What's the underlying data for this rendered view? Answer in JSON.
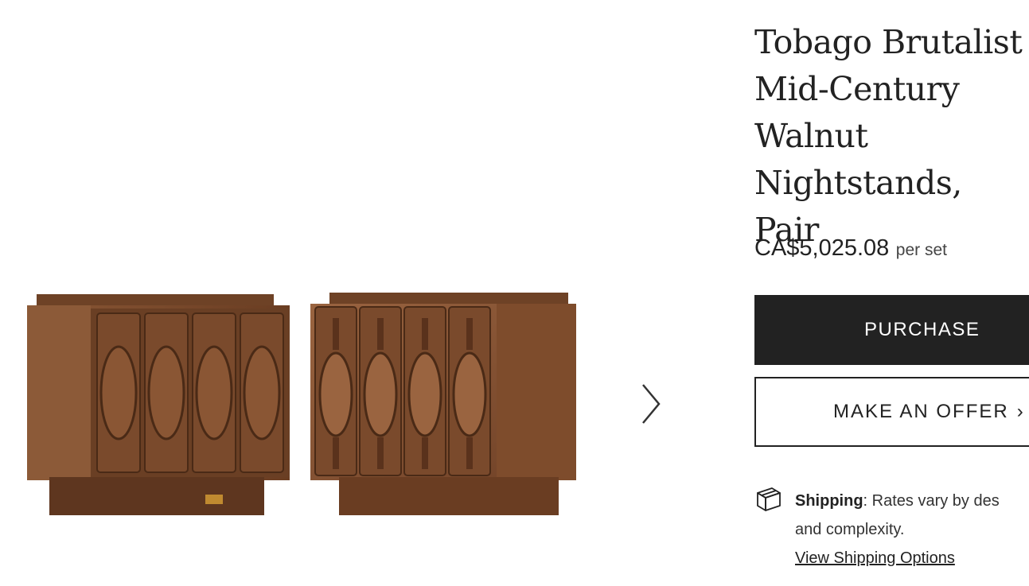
{
  "product": {
    "title_lines": [
      "Tobago Brutalist",
      "Mid-Century",
      "Walnut",
      "Nightstands, Pair"
    ],
    "price": "CA$5,025.08",
    "price_unit": "per set"
  },
  "actions": {
    "purchase_label": "PURCHASE",
    "offer_label": "MAKE AN OFFER"
  },
  "shipping": {
    "label": "Shipping",
    "text_part1": ": Rates vary by des",
    "text_part2": "and complexity.",
    "link_label": "View Shipping Options"
  },
  "gallery": {
    "image_description_icon": "nightstand-pair-image",
    "next_icon": "chevron-right-icon"
  },
  "colors": {
    "button_dark": "#222222",
    "wood_dark": "#5b3520",
    "wood_mid": "#7a4a2c",
    "wood_light": "#9a6440"
  }
}
